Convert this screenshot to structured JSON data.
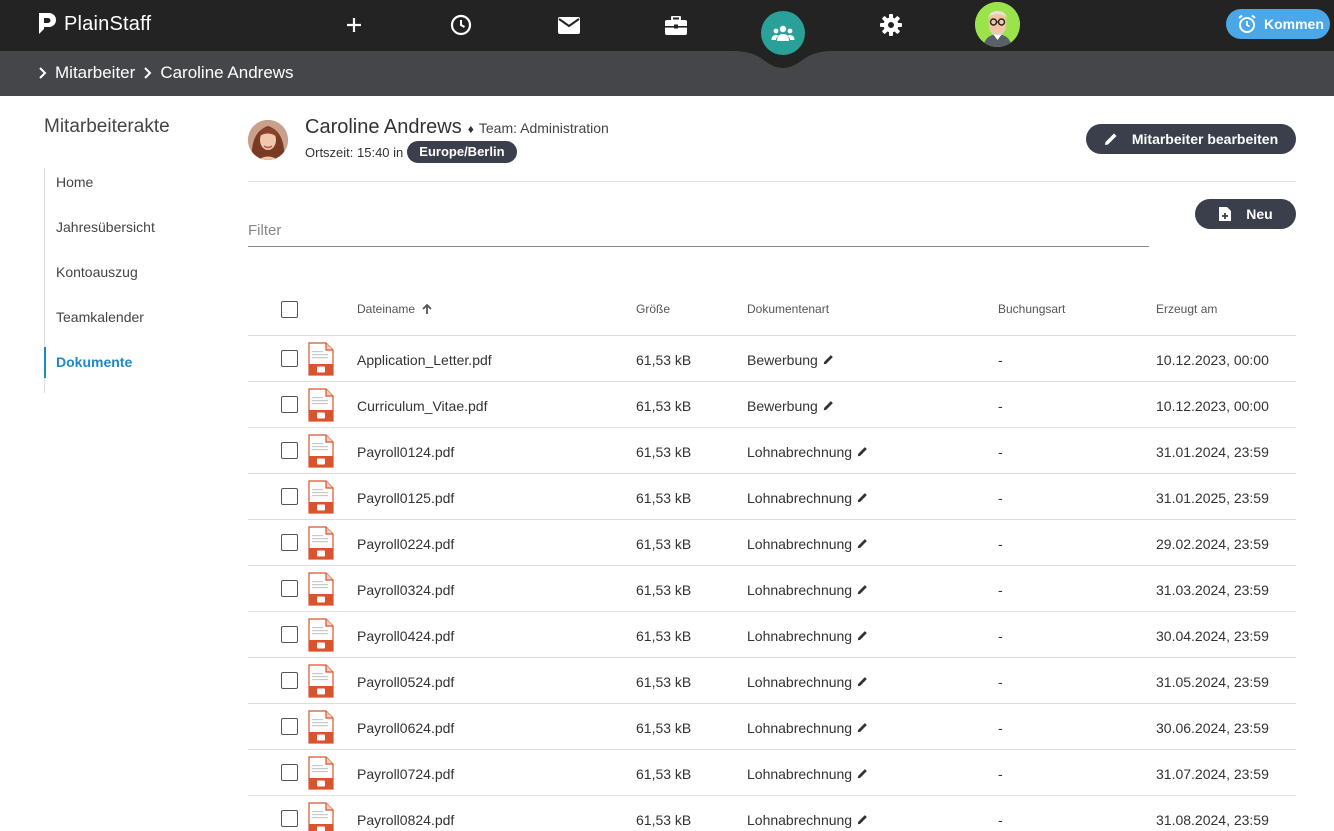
{
  "app": {
    "name": "PlainStaff"
  },
  "topnav": {
    "icons": [
      "plus-icon",
      "clock-icon",
      "mail-icon",
      "briefcase-icon",
      "team-icon",
      "gear-icon"
    ],
    "kommen_label": "Kommen",
    "colors": {
      "bar": "#232323",
      "active": "#2aa198",
      "kommen": "#4aa8e8"
    }
  },
  "breadcrumb": {
    "items": [
      "Mitarbeiter",
      "Caroline Andrews"
    ]
  },
  "sidebar": {
    "title": "Mitarbeiterakte",
    "items": [
      {
        "label": "Home"
      },
      {
        "label": "Jahresübersicht"
      },
      {
        "label": "Kontoauszug"
      },
      {
        "label": "Teamkalender"
      },
      {
        "label": "Dokumente",
        "active": true
      }
    ],
    "active_color": "#1e88c7"
  },
  "profile": {
    "name": "Caroline Andrews",
    "separator": "♦",
    "team": "Team: Administration",
    "time_label": "Ortszeit: 15:40 in",
    "timezone": "Europe/Berlin",
    "edit_button": "Mitarbeiter bearbeiten"
  },
  "filter": {
    "placeholder": "Filter",
    "value": ""
  },
  "new_button": "Neu",
  "table": {
    "columns": {
      "filename": "Dateiname",
      "size": "Größe",
      "doctype": "Dokumentenart",
      "booking": "Buchungsart",
      "created": "Erzeugt am"
    },
    "sort": {
      "column": "Dateiname",
      "direction": "ascending"
    },
    "rows": [
      {
        "name": "Application_Letter.pdf",
        "size": "61,53 kB",
        "doctype": "Bewerbung",
        "booking": "-",
        "created": "10.12.2023, 00:00"
      },
      {
        "name": "Curriculum_Vitae.pdf",
        "size": "61,53 kB",
        "doctype": "Bewerbung",
        "booking": "-",
        "created": "10.12.2023, 00:00"
      },
      {
        "name": "Payroll0124.pdf",
        "size": "61,53 kB",
        "doctype": "Lohnabrechnung",
        "booking": "-",
        "created": "31.01.2024, 23:59"
      },
      {
        "name": "Payroll0125.pdf",
        "size": "61,53 kB",
        "doctype": "Lohnabrechnung",
        "booking": "-",
        "created": "31.01.2025, 23:59"
      },
      {
        "name": "Payroll0224.pdf",
        "size": "61,53 kB",
        "doctype": "Lohnabrechnung",
        "booking": "-",
        "created": "29.02.2024, 23:59"
      },
      {
        "name": "Payroll0324.pdf",
        "size": "61,53 kB",
        "doctype": "Lohnabrechnung",
        "booking": "-",
        "created": "31.03.2024, 23:59"
      },
      {
        "name": "Payroll0424.pdf",
        "size": "61,53 kB",
        "doctype": "Lohnabrechnung",
        "booking": "-",
        "created": "30.04.2024, 23:59"
      },
      {
        "name": "Payroll0524.pdf",
        "size": "61,53 kB",
        "doctype": "Lohnabrechnung",
        "booking": "-",
        "created": "31.05.2024, 23:59"
      },
      {
        "name": "Payroll0624.pdf",
        "size": "61,53 kB",
        "doctype": "Lohnabrechnung",
        "booking": "-",
        "created": "30.06.2024, 23:59"
      },
      {
        "name": "Payroll0724.pdf",
        "size": "61,53 kB",
        "doctype": "Lohnabrechnung",
        "booking": "-",
        "created": "31.07.2024, 23:59"
      },
      {
        "name": "Payroll0824.pdf",
        "size": "61,53 kB",
        "doctype": "Lohnabrechnung",
        "booking": "-",
        "created": "31.08.2024, 23:59"
      }
    ]
  }
}
